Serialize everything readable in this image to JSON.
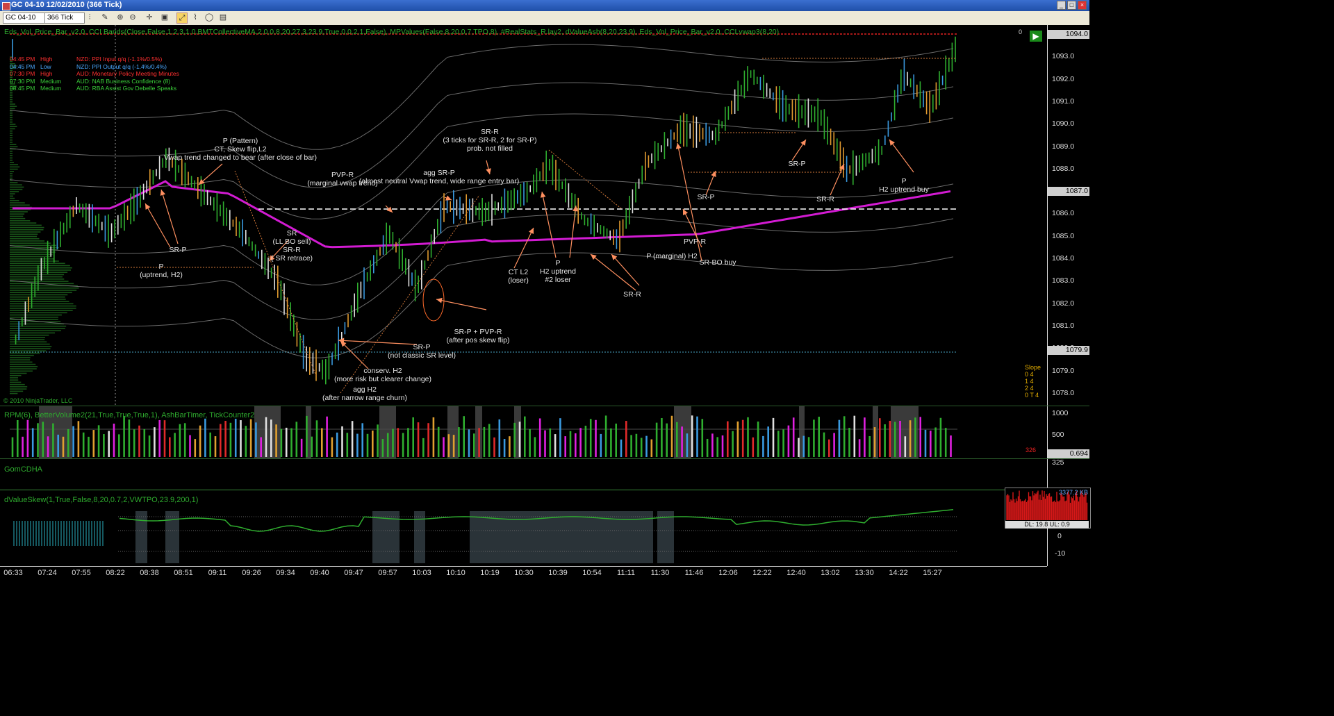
{
  "window": {
    "title": "GC 04-10  12/02/2010 (366 Tick)",
    "buttons": [
      "_",
      "□",
      "×"
    ]
  },
  "toolbar": {
    "instrument": "GC 04-10",
    "period": "366 Tick"
  },
  "price_panel": {
    "indicators": "Eds_Vol_Price_Bar_v2.0, CCI Bands(Close,False,1,2,3,1,0,BMTCollectiveMA,2,0,0,8,20,27,3,23,9,True,0,0,2,1,False), MPValues(False,8,20,0,7,TPO,8), #RealStats_R.lay2, dValueAsh(8,20,23,9), Eds_Vol_Price_Bar_v2.0, CCLvwap3(8,20)",
    "copyright": "© 2010 NinjaTrader, LLC",
    "top_right_value": "0",
    "news": [
      {
        "time": "04:45 PM",
        "impact": "High",
        "event": "NZD: PPI Input q/q (-1.1%/0.5%)",
        "color": "#ff3030"
      },
      {
        "time": "04:45 PM",
        "impact": "Low",
        "event": "NZD: PPI Output q/q (-1.4%/0.4%)",
        "color": "#4aa8ff"
      },
      {
        "time": "07:30 PM",
        "impact": "High",
        "event": "AUD: Monetary Policy Meeting Minutes",
        "color": "#ff3030"
      },
      {
        "time": "07:30 PM",
        "impact": "Medium",
        "event": "AUD: NAB Business Confidence (8)",
        "color": "#3ad03a"
      },
      {
        "time": "08:45 PM",
        "impact": "Medium",
        "event": "AUD: RBA Assist Gov Debelle Speaks",
        "color": "#3ad03a"
      }
    ],
    "annotations": [
      "P (Pattern)\nCT, Skew flip,L2\nVwap trend changed to bear (after close of bar)",
      "SR-P",
      "P\n(uptrend, H2)",
      "PVP-R\n(marginal vwap trend)",
      "SR\n(LL BO sell)\nSR-R\n( SR retrace)",
      "SR-R\n(3 ticks for SR-R, 2 for SR-P)\nprob. not filled",
      "agg SR-P\n(almost neutral Vwap trend, wide range entry bar)",
      "SR-P + PVP-R\n(after pos skew flip)",
      "SR-P\n(not classic SR level)",
      "conserv. H2\n(more risk but clearer change)",
      "agg H2\n(after narrow range churn)",
      "CT L2\n(loser)",
      "P\nH2 uptrend\n#2 loser",
      "SR-R",
      "P (marginal) H2",
      "PVP-R",
      "SR-BO buy",
      "SR-P",
      "SR-P",
      "SR-R",
      "P\nH2 uptrend buy"
    ],
    "slope": {
      "title": "Slope",
      "rows": [
        "0  4",
        "1  4",
        "2  4",
        "0 T  4"
      ]
    }
  },
  "price_axis": {
    "ticks": [
      "1094.0",
      "1093.0",
      "1092.0",
      "1091.0",
      "1090.0",
      "1089.0",
      "1088.0",
      "1087.0",
      "1086.0",
      "1085.0",
      "1084.0",
      "1083.0",
      "1082.0",
      "1081.0",
      "1080.0",
      "1079.0",
      "1078.0"
    ],
    "badges": [
      {
        "label": "1094.0",
        "color": "#cfcfcf"
      },
      {
        "label": "1087.0",
        "color": "#cfcfcf"
      },
      {
        "label": "1079.9",
        "color": "#cfcfcf"
      }
    ]
  },
  "volume_panel": {
    "label": "RPM(6), BetterVolume2(21,True,True,True,1), AshBarTimer, TickCounter2",
    "axis": [
      "1000",
      "500"
    ],
    "tick_counter": "326",
    "badge": "0.694"
  },
  "cdha_panel": {
    "label": "GomCDHA",
    "axis": [
      "325"
    ]
  },
  "skew_panel": {
    "label": "dValueSkew(1,True,False,8,20,0.7,2,VWTPO,23.9,200,1)",
    "axis": [
      "0",
      "-10"
    ]
  },
  "net_meter": {
    "kb": "3377.2 KB",
    "dl_ul": "DL: 19.8  UL: 0.9"
  },
  "time_axis": {
    "ticks": [
      "06:33",
      "07:24",
      "07:55",
      "08:22",
      "08:38",
      "08:51",
      "09:11",
      "09:26",
      "09:34",
      "09:40",
      "09:47",
      "09:57",
      "10:03",
      "10:10",
      "10:19",
      "10:30",
      "10:39",
      "10:54",
      "11:11",
      "11:30",
      "11:46",
      "12:06",
      "12:22",
      "12:40",
      "13:02",
      "13:30",
      "14:22",
      "15:27"
    ]
  },
  "colors": {
    "up_bar": "#2fae2f",
    "down_bar": "#e0e0e0",
    "vwap": "#d21bd2",
    "annotation_arrow": "#ff9060",
    "band": "#6a6a6a"
  }
}
